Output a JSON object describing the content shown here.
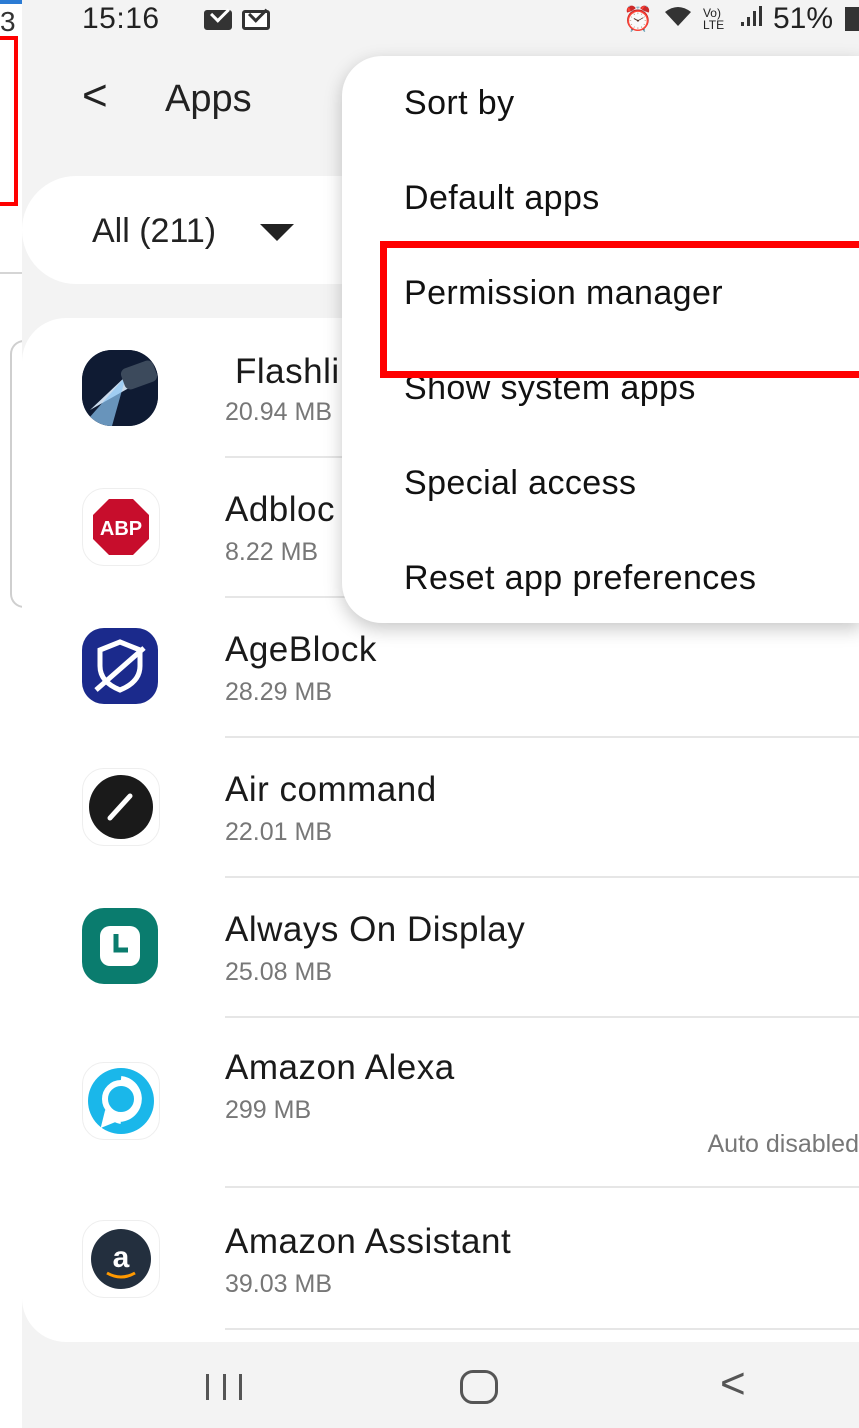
{
  "left_edge": {
    "digit": "3"
  },
  "status_bar": {
    "time": "15:16",
    "icons": [
      "mail-icon",
      "mail-outline-icon",
      "alarm-icon",
      "wifi-icon",
      "volte-icon",
      "signal-icon"
    ],
    "volte": "Vo) LTE",
    "battery": "51%"
  },
  "header": {
    "back_glyph": "<",
    "title": "Apps"
  },
  "filter": {
    "label": "All (211)"
  },
  "apps": [
    {
      "name": "Flashli",
      "size": "20.94 MB",
      "icon": "flashlight-icon"
    },
    {
      "name": "Adbloc",
      "size": "8.22 MB",
      "icon": "abp-icon",
      "icon_text": "ABP"
    },
    {
      "name": "AgeBlock",
      "size": "28.29 MB",
      "icon": "ageblock-icon"
    },
    {
      "name": "Air command",
      "size": "22.01 MB",
      "icon": "pen-icon"
    },
    {
      "name": "Always On Display",
      "size": "25.08 MB",
      "icon": "clock-icon"
    },
    {
      "name": "Amazon Alexa",
      "size": "299 MB",
      "icon": "alexa-icon",
      "note": "Auto disabled"
    },
    {
      "name": "Amazon Assistant",
      "size": "39.03 MB",
      "icon": "amazon-icon",
      "icon_text": "a"
    }
  ],
  "menu": {
    "items": [
      "Sort by",
      "Default apps",
      "Permission manager",
      "Show system apps",
      "Special access",
      "Reset app preferences"
    ],
    "highlighted": "Permission manager"
  },
  "nav": {
    "icons": [
      "recents-icon",
      "home-icon",
      "back-icon"
    ],
    "back_glyph": "<"
  },
  "colors": {
    "highlight": "#ff0000",
    "background": "#f3f3f3",
    "card": "#ffffff",
    "alexa": "#1ab7ea",
    "aod": "#0a7c6e",
    "ageblock": "#1b2a8c",
    "abp": "#c70d2c"
  }
}
